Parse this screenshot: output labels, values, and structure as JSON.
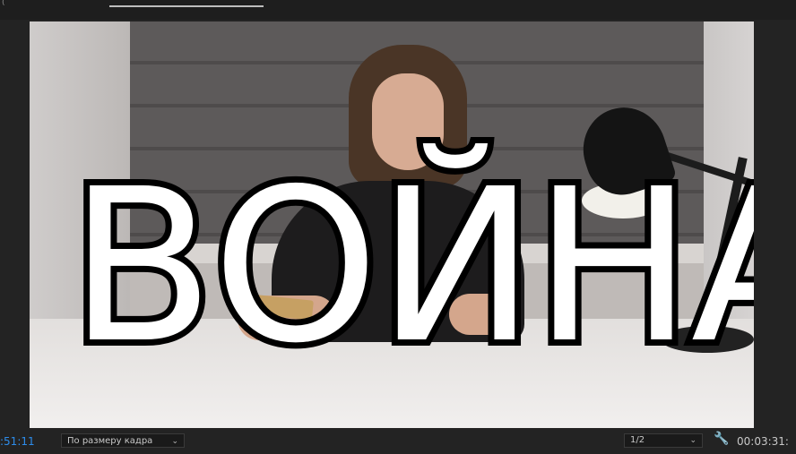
{
  "topbar": {
    "tab1_label": "(",
    "tab2_label": ""
  },
  "viewer": {
    "overlay_text": "ВОЙНА"
  },
  "bottombar": {
    "timecode_current": ":51:11",
    "fit_option": "По размеру кадра",
    "resolution_option": "1/2",
    "timecode_total": "00:03:31:",
    "wrench_icon": "wrench-icon",
    "chevron_icon": "chevron-down-icon"
  },
  "colors": {
    "timecode_blue": "#2d8ceb",
    "panel_bg": "#232323"
  }
}
